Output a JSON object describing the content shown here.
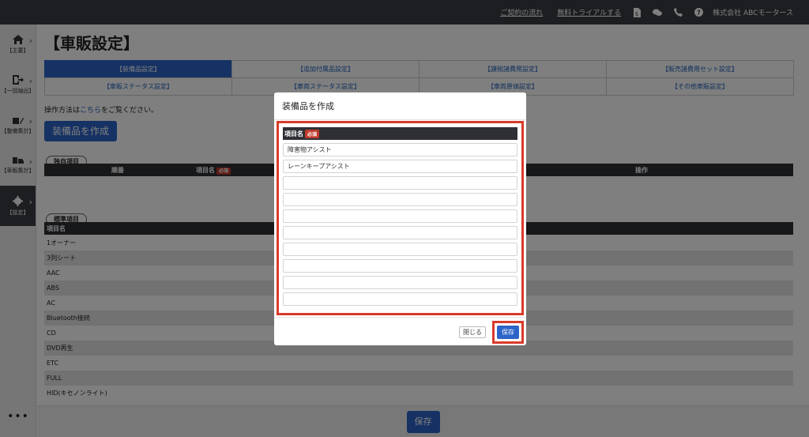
{
  "topbar": {
    "link_contract": "ご契約の流れ",
    "link_trial": "無料トライアルする",
    "company": "株式会社 ABCモータース",
    "icons": [
      "document-dollar-icon",
      "chat-icon",
      "phone-icon",
      "help-icon"
    ]
  },
  "sidebar": {
    "items": [
      {
        "label": "【主要】",
        "icon": "home-icon"
      },
      {
        "label": "【一括抽出】",
        "icon": "export-icon"
      },
      {
        "label": "【整備集計】",
        "icon": "tools-icon"
      },
      {
        "label": "【車販集計】",
        "icon": "car-icon"
      },
      {
        "label": "【設定】",
        "icon": "gear-icon",
        "active": true
      }
    ],
    "more": "•••"
  },
  "main": {
    "title": "【車販設定】",
    "tabs": [
      "【装備品設定】",
      "【追加付属品設定】",
      "【課税諸費用設定】",
      "【販売諸費用セット設定】",
      "【車販ステータス設定】",
      "【車両ステータス設定】",
      "【車両原価設定】",
      "【その他車販設定】"
    ],
    "help_prefix": "操作方法は",
    "help_link": "こちら",
    "help_suffix": "をご覧ください。",
    "create_button": "装備品を作成",
    "custom_section": {
      "tag": "独自項目",
      "col_order": "順番",
      "col_name": "項目名",
      "required": "必須",
      "col_action": "操作"
    },
    "standard_section": {
      "tag": "標準項目",
      "col_name": "項目名",
      "rows": [
        "1オーナー",
        "3列シート",
        "AAC",
        "ABS",
        "AC",
        "Bluetooth接続",
        "CD",
        "DVD再生",
        "ETC",
        "FULL",
        "HID(キセノンライト)"
      ]
    },
    "footer_save": "保存"
  },
  "modal": {
    "title": "装備品を作成",
    "col_name": "項目名",
    "required": "必須",
    "inputs": [
      "障害物アシスト",
      "レーンキープアシスト",
      "",
      "",
      "",
      "",
      "",
      "",
      "",
      "",
      ""
    ],
    "close_button": "閉じる",
    "save_button": "保存"
  },
  "colors": {
    "accent": "#2d64c8",
    "highlight": "#d93a2b",
    "dark": "#3a3d42"
  }
}
